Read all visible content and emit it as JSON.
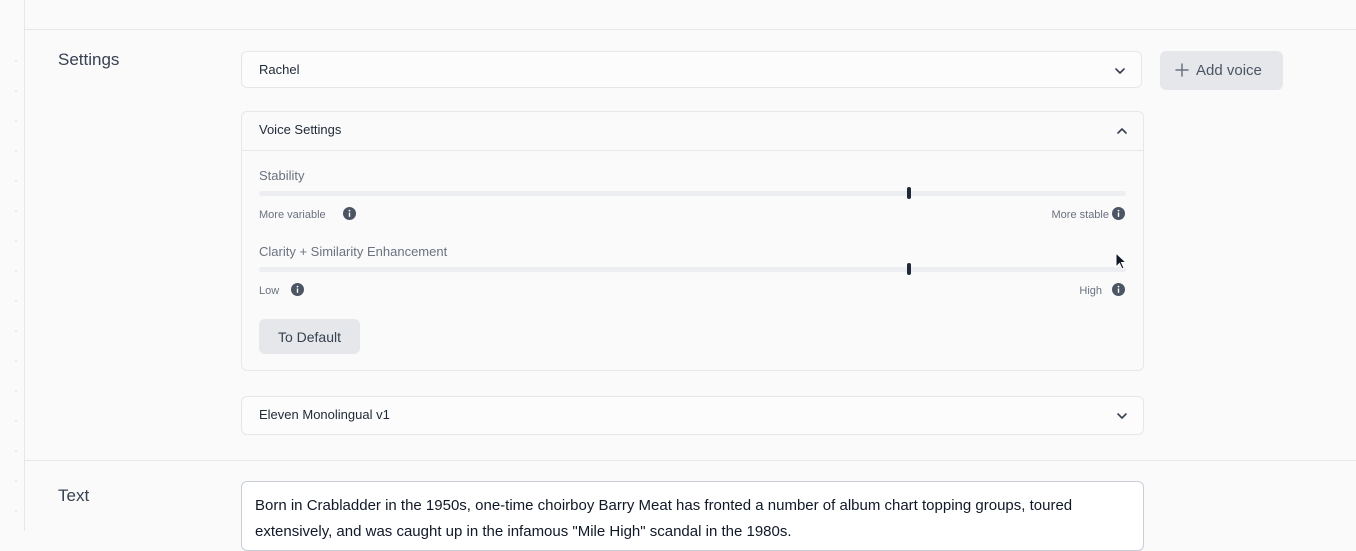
{
  "sections": {
    "settings_label": "Settings",
    "text_label": "Text"
  },
  "voice_select": {
    "selected": "Rachel",
    "icon": "chevron-down-icon"
  },
  "add_voice": {
    "label": "Add voice",
    "icon": "plus-icon"
  },
  "voice_settings": {
    "title": "Voice Settings",
    "icon": "chevron-up-icon",
    "sliders": [
      {
        "label": "Stability",
        "min_label": "More variable",
        "max_label": "More stable",
        "value_fraction": 0.75
      },
      {
        "label": "Clarity + Similarity Enhancement",
        "min_label": "Low",
        "max_label": "High",
        "value_fraction": 0.75
      }
    ],
    "reset_label": "To Default"
  },
  "model_select": {
    "selected": "Eleven Monolingual v1",
    "icon": "chevron-down-icon"
  },
  "text_input": {
    "value": "Born in Crabladder in the 1950s, one-time choirboy Barry Meat has fronted a number of album chart topping groups, toured extensively, and was caught up in the infamous \"Mile High\" scandal in the 1980s."
  },
  "colors": {
    "accent_dark": "#1f2937",
    "button_bg": "#e5e7eb",
    "border": "#e5e7eb"
  }
}
